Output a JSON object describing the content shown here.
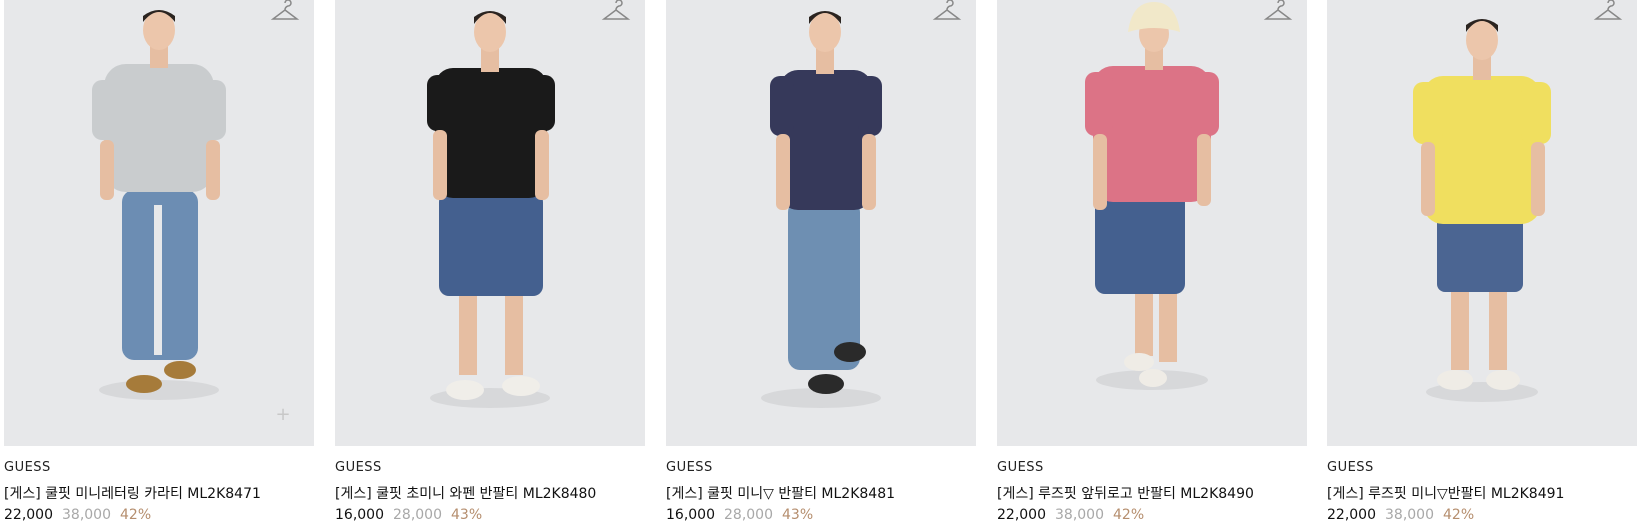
{
  "products": [
    {
      "brand": "GUESS",
      "name": "[게스] 쿨핏 미니레터링 카라티 ML2K8471",
      "sale": "22,000",
      "orig": "38,000",
      "disc": "42%",
      "shirt": "#c9ccce",
      "bottom": "#6c8db3",
      "shoe": "#a67b3a",
      "hat": "",
      "has_plus": true
    },
    {
      "brand": "GUESS",
      "name": "[게스] 쿨핏 초미니 와펜 반팔티 ML2K8480",
      "sale": "16,000",
      "orig": "28,000",
      "disc": "43%",
      "shirt": "#1a1a1a",
      "bottom": "#44608f",
      "shoe": "#f0eee9",
      "hat": ""
    },
    {
      "brand": "GUESS",
      "name": "[게스] 쿨핏 미니▽ 반팔티 ML2K8481",
      "sale": "16,000",
      "orig": "28,000",
      "disc": "43%",
      "shirt": "#36395a",
      "bottom": "#6e8fb2",
      "shoe": "#2a2a2a",
      "hat": ""
    },
    {
      "brand": "GUESS",
      "name": "[게스] 루즈핏 앞뒤로고 반팔티 ML2K8490",
      "sale": "22,000",
      "orig": "38,000",
      "disc": "42%",
      "shirt": "#dc7386",
      "bottom": "#44608f",
      "shoe": "#efece6",
      "hat": "#f1e8c9"
    },
    {
      "brand": "GUESS",
      "name": "[게스] 루즈핏 미니▽반팔티 ML2K8491",
      "sale": "22,000",
      "orig": "38,000",
      "disc": "42%",
      "shirt": "#f0df5f",
      "bottom": "#4b6592",
      "shoe": "#efece6",
      "hat": ""
    }
  ],
  "icons": {
    "hanger": "hanger-icon",
    "plus": "plus-icon"
  }
}
